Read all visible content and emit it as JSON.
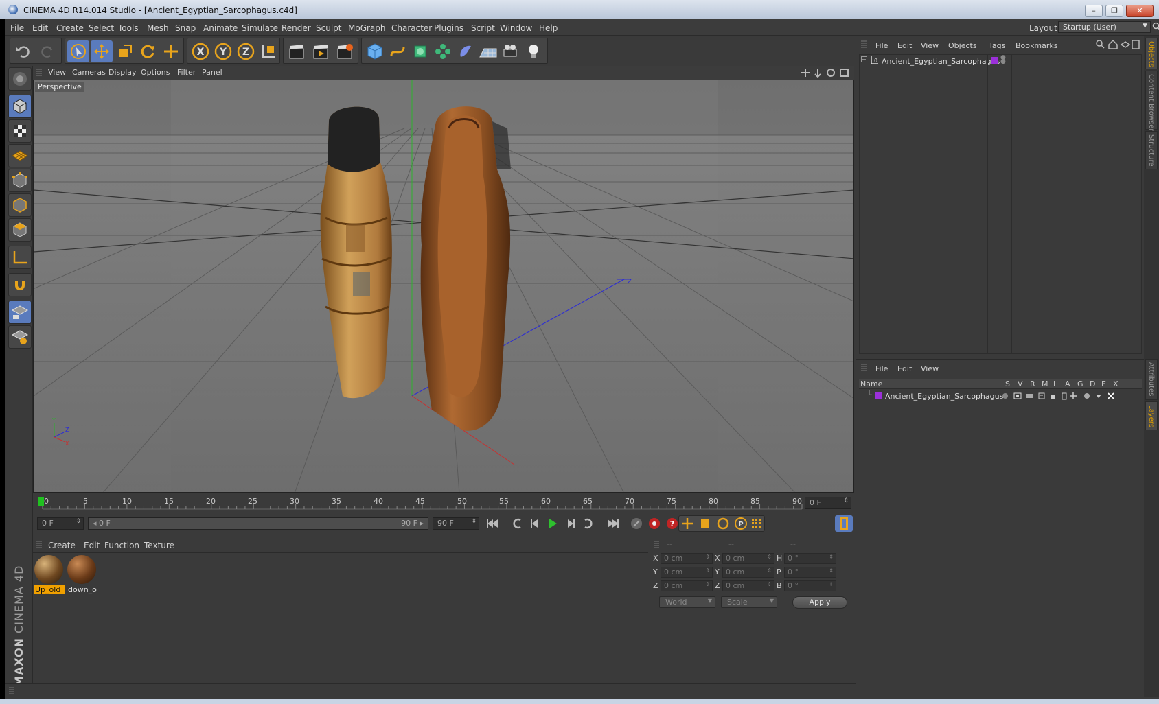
{
  "window": {
    "title": "CINEMA 4D R14.014 Studio - [Ancient_Egyptian_Sarcophagus.c4d]",
    "minimize": "–",
    "restore": "❐",
    "close": "✕"
  },
  "menubar": {
    "items": [
      "File",
      "Edit",
      "Create",
      "Select",
      "Tools",
      "Mesh",
      "Snap",
      "Animate",
      "Simulate",
      "Render",
      "Sculpt",
      "MoGraph",
      "Character",
      "Plugins",
      "Script",
      "Window",
      "Help"
    ],
    "layout_label": "Layout:",
    "layout_value": "Startup (User)"
  },
  "viewport": {
    "menu": [
      "View",
      "Cameras",
      "Display",
      "Options",
      "Filter",
      "Panel"
    ],
    "label": "Perspective"
  },
  "timeline": {
    "ticks": [
      "0",
      "5",
      "10",
      "15",
      "20",
      "25",
      "30",
      "35",
      "40",
      "45",
      "50",
      "55",
      "60",
      "65",
      "70",
      "75",
      "80",
      "85",
      "90"
    ],
    "current_frame_field": "0 F",
    "start_field": "0 F",
    "range_start": "0 F",
    "range_end": "90 F",
    "end_field": "90 F"
  },
  "materials": {
    "menu": [
      "Create",
      "Edit",
      "Function",
      "Texture"
    ],
    "items": [
      {
        "name": "Up_old",
        "selected": true
      },
      {
        "name": "down_o",
        "selected": false
      }
    ]
  },
  "coordinates": {
    "headers": [
      "--",
      "--",
      "--"
    ],
    "rows": [
      {
        "l1": "X",
        "v1": "0 cm",
        "l2": "X",
        "v2": "0 cm",
        "l3": "H",
        "v3": "0 °"
      },
      {
        "l1": "Y",
        "v1": "0 cm",
        "l2": "Y",
        "v2": "0 cm",
        "l3": "P",
        "v3": "0 °"
      },
      {
        "l1": "Z",
        "v1": "0 cm",
        "l2": "Z",
        "v2": "0 cm",
        "l3": "B",
        "v3": "0 °"
      }
    ],
    "space": "World",
    "mode": "Scale",
    "apply": "Apply"
  },
  "objects": {
    "menu": [
      "File",
      "Edit",
      "View",
      "Objects",
      "Tags",
      "Bookmarks"
    ],
    "items": [
      {
        "name": "Ancient_Egyptian_Sarcophagus",
        "color": "#9b30d9"
      }
    ]
  },
  "layers": {
    "menu": [
      "File",
      "Edit",
      "View"
    ],
    "columns": [
      "Name",
      "S",
      "V",
      "R",
      "M",
      "L",
      "A",
      "G",
      "D",
      "E",
      "X"
    ],
    "items": [
      {
        "name": "Ancient_Egyptian_Sarcophagus",
        "color": "#9b30d9"
      }
    ]
  },
  "right_tabs": [
    "Objects",
    "Content Browser",
    "Structure",
    "Attributes",
    "Layers"
  ],
  "logo": {
    "brand": "MAXON",
    "product": "CINEMA 4D"
  },
  "colors": {
    "accent": "#5a7bbd",
    "selection": "#f0a000",
    "background": "#3a3a3a"
  }
}
